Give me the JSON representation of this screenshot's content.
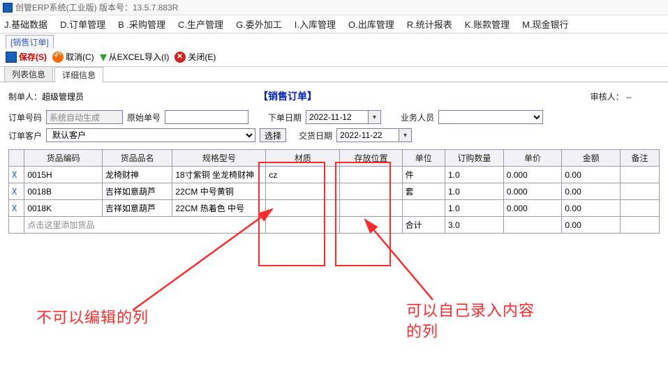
{
  "window": {
    "title": "创管ERP系统(工业版)  版本号：13.5.7.883R"
  },
  "menu": [
    "J.基础数据",
    "D.订单管理",
    "B .采购管理",
    "C.生产管理",
    "G.委外加工",
    "I.入库管理",
    "O.出库管理",
    "R.统计报表",
    "K.账款管理",
    "M.现金银行"
  ],
  "doc_tab": "[销售订单]",
  "toolbar": {
    "save": "保存(S)",
    "cancel": "取消(C)",
    "import": "从EXCEL导入(I)",
    "close": "关闭(E)"
  },
  "subtabs": {
    "list": "列表信息",
    "detail": "详细信息"
  },
  "header": {
    "creator_label": "制单人：",
    "creator_value": "超级管理员",
    "title": "【销售订单】",
    "reviewer_label": "审核人：",
    "reviewer_value": "--"
  },
  "form": {
    "order_no_label": "订单号码",
    "order_no_value": "系统自动生成",
    "origin_no_label": "原始单号",
    "origin_no_value": "",
    "order_date_label": "下单日期",
    "order_date_value": "2022-11-12",
    "sales_label": "业务人员",
    "sales_value": "",
    "customer_label": "订单客户",
    "customer_value": "默认客户",
    "select_btn": "选择",
    "deliver_date_label": "交货日期",
    "deliver_date_value": "2022-11-22"
  },
  "grid": {
    "cols": [
      "货品编码",
      "货品品名",
      "规格型号",
      "材质",
      "存放位置",
      "单位",
      "订购数量",
      "单价",
      "金额",
      "备注"
    ],
    "rows": [
      {
        "mark": "X",
        "code": "0015H",
        "name": "龙椅财神",
        "spec": "18寸紫铜 坐龙椅财神",
        "material": "cz",
        "loc": "",
        "unit": "件",
        "qty": "1.0",
        "price": "0.000",
        "amount": "0.00",
        "remark": ""
      },
      {
        "mark": "X",
        "code": "0018B",
        "name": "吉祥如意葫芦",
        "spec": "22CM 中号黄铜",
        "material": "",
        "loc": "",
        "unit": "套",
        "qty": "1.0",
        "price": "0.000",
        "amount": "0.00",
        "remark": ""
      },
      {
        "mark": "X",
        "code": "0018K",
        "name": "吉祥如意葫芦",
        "spec": "22CM 热着色 中号",
        "material": "",
        "loc": "",
        "unit": "",
        "qty": "1.0",
        "price": "0.000",
        "amount": "0.00",
        "remark": ""
      }
    ],
    "addrow_text": "点击这里添加货品",
    "total_label": "合计",
    "total_qty": "3.0",
    "total_amount": "0.00"
  },
  "annotations": {
    "left_text": "不可以编辑的列",
    "right_text_l1": "可以自己录入内容",
    "right_text_l2": "的列"
  }
}
